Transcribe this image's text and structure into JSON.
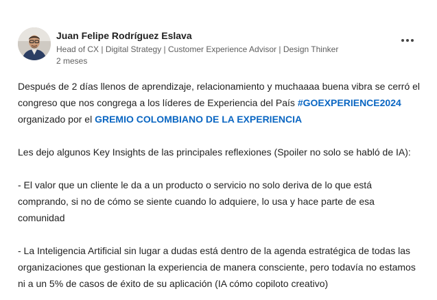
{
  "author": {
    "name": "Juan Felipe Rodríguez Eslava",
    "headline": "Head of CX | Digital Strategy | Customer Experience Advisor | Design Thinker",
    "time": "2 meses"
  },
  "post": {
    "p1_text_1": "Después de 2 días llenos de aprendizaje, relacionamiento y muchaaaa buena vibra se cerró el congreso que nos congrega a los líderes de Experiencia del País ",
    "hashtag": "#GOEXPERIENCE2024",
    "p1_text_2": "organizado por el ",
    "mention": "GREMIO COLOMBIANO DE LA EXPERIENCIA",
    "p2": "Les dejo algunos Key Insights de las principales reflexiones (Spoiler no solo se habló de IA):",
    "p3": "- El valor que un cliente le da a un producto o servicio no solo deriva de lo que está comprando, si no de cómo se siente cuando lo adquiere, lo usa y hace parte de esa comunidad",
    "p4": "- La Inteligencia Artificial sin lugar a dudas está dentro de la agenda estratégica de todas las organizaciones que gestionan la experiencia de manera consciente, pero todavía no estamos ni a un 5% de casos de éxito de su aplicación (IA cómo copiloto creativo)"
  },
  "colors": {
    "link": "#0a66c2",
    "text": "#1f1f1f",
    "muted": "#5e5e5e"
  },
  "icons": {
    "more": "more-horizontal-icon"
  }
}
